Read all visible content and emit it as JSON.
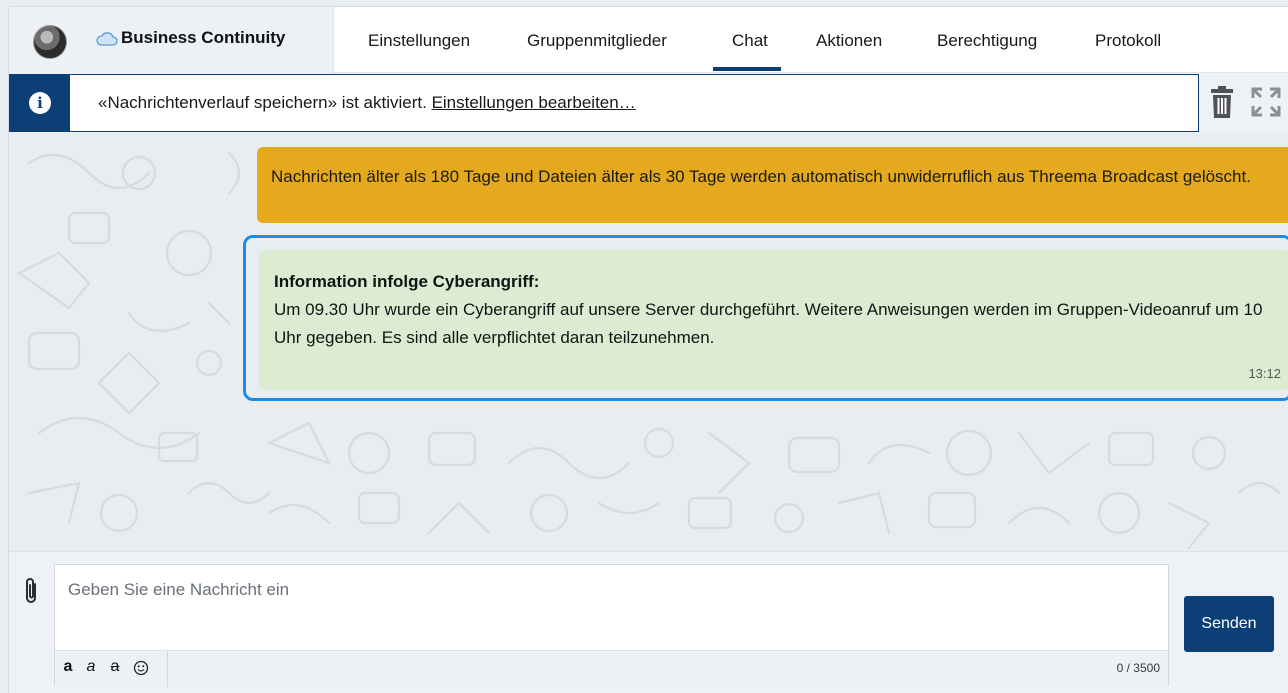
{
  "header": {
    "group_name": "Business Continuity",
    "tabs": [
      {
        "label": "Einstellungen"
      },
      {
        "label": "Gruppenmitglieder"
      },
      {
        "label": "Chat"
      },
      {
        "label": "Aktionen"
      },
      {
        "label": "Berechtigung"
      },
      {
        "label": "Protokoll"
      }
    ],
    "active_tab": "Chat"
  },
  "info_bar": {
    "text": "«Nachrichtenverlauf speichern» ist aktiviert.",
    "link": "Einstellungen bearbeiten…"
  },
  "system_message": {
    "text": "Nachrichten älter als 180 Tage und Dateien älter als 30 Tage werden automatisch unwiderruflich aus Threema Broadcast gelöscht."
  },
  "message": {
    "title": "Information infolge Cyberangriff:",
    "body": "Um 09.30 Uhr wurde ein Cyberangriff auf unsere Server durchgeführt. Weitere Anweisungen werden im Gruppen-Videoanruf um 10 Uhr gegeben. Es sind alle verpflichtet daran teilzunehmen.",
    "time": "13:12"
  },
  "composer": {
    "placeholder": "Geben Sie eine Nachricht ein",
    "format_buttons": [
      "a",
      "a",
      "a"
    ],
    "char_count": "0 / 3500",
    "send_label": "Senden"
  },
  "colors": {
    "brand": "#0c3f75",
    "system_message_bg": "#e4a91c",
    "message_bg": "#dbecd3",
    "selection_border": "#1a8be8"
  },
  "icons": [
    "cloud-icon",
    "info-icon",
    "trash-icon",
    "expand-icon",
    "paperclip-icon",
    "emoji-icon"
  ]
}
